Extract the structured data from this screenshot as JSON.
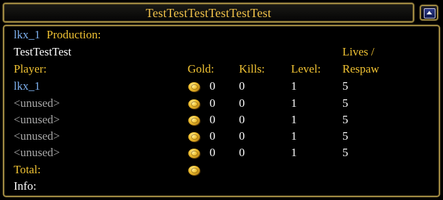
{
  "window": {
    "title": "TestTestTestTestTestTest"
  },
  "header": {
    "player_name": "lkx_1",
    "production_label": "Production:",
    "production_value": "TestTestTest"
  },
  "columns": {
    "player": "Player:",
    "gold": "Gold:",
    "kills": "Kills:",
    "level": "Level:",
    "lives_line1": "Lives /",
    "lives_line2": "Respaw"
  },
  "rows": [
    {
      "name": "lkx_1",
      "gold": "0",
      "kills": "0",
      "level": "1",
      "lives": "5",
      "active": true
    },
    {
      "name": "<unused>",
      "gold": "0",
      "kills": "0",
      "level": "1",
      "lives": "5",
      "active": false
    },
    {
      "name": "<unused>",
      "gold": "0",
      "kills": "0",
      "level": "1",
      "lives": "5",
      "active": false
    },
    {
      "name": "<unused>",
      "gold": "0",
      "kills": "0",
      "level": "1",
      "lives": "5",
      "active": false
    },
    {
      "name": "<unused>",
      "gold": "0",
      "kills": "0",
      "level": "1",
      "lives": "5",
      "active": false
    }
  ],
  "footer": {
    "total_label": "Total:",
    "info_label": "Info:"
  },
  "icons": {
    "coin": "gold-coin-icon",
    "minimize": "minimize-arrow-icon"
  },
  "colors": {
    "gold_text": "#f0c233",
    "player_blue": "#7fb2f0",
    "unused_grey": "#a8a8a8",
    "border": "#a08a42"
  }
}
